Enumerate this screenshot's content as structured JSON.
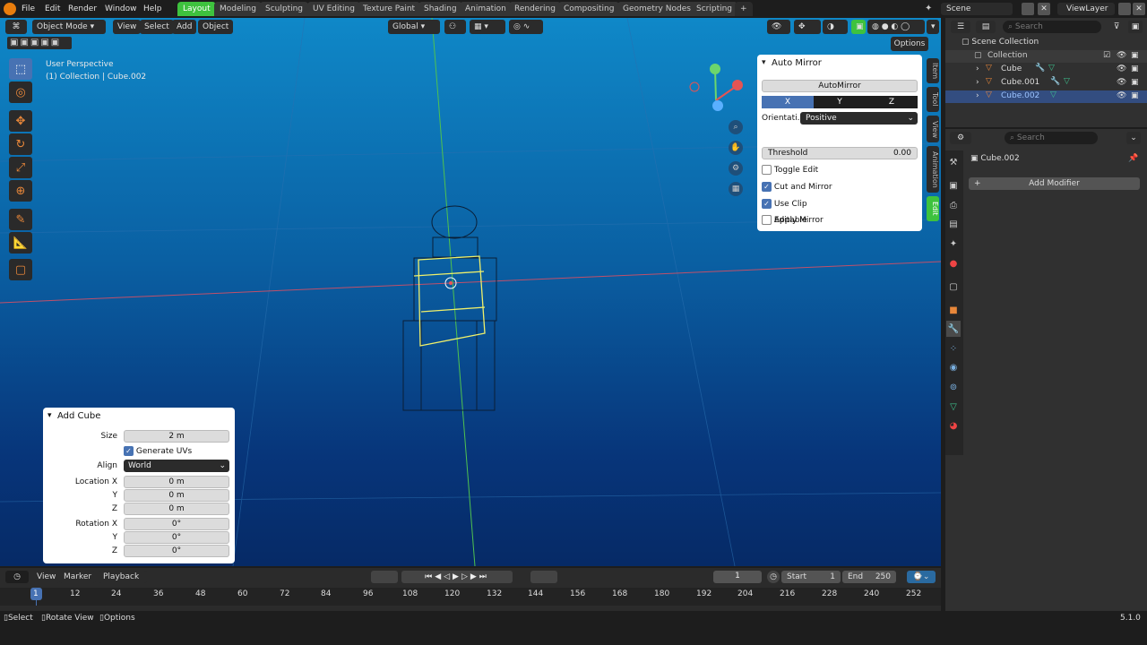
{
  "topbar": {
    "menus": [
      "File",
      "Edit",
      "Render",
      "Window",
      "Help"
    ],
    "workspaces": [
      "Layout",
      "Modeling",
      "Sculpting",
      "UV Editing",
      "Texture Paint",
      "Shading",
      "Animation",
      "Rendering",
      "Compositing",
      "Geometry Nodes",
      "Scripting"
    ],
    "active_workspace": "Layout",
    "add_tab": "+",
    "scene": "Scene",
    "view_layer": "ViewLayer"
  },
  "viewport": {
    "mode": "Object Mode",
    "menus": [
      "View",
      "Select",
      "Add",
      "Object"
    ],
    "orientation": "Global",
    "options": "Options",
    "info_line1": "User Perspective",
    "info_line2": "(1) Collection | Cube.002"
  },
  "side_tabs": [
    "Item",
    "Tool",
    "View",
    "Animation",
    "Edit"
  ],
  "auto_mirror": {
    "title": "Auto Mirror",
    "button": "AutoMirror",
    "axes": [
      "X",
      "Y",
      "Z"
    ],
    "orientation_label": "Orientati...",
    "orientation_value": "Positive",
    "threshold_label": "Threshold",
    "threshold_value": "0.00",
    "options": [
      {
        "label": "Toggle Edit",
        "checked": false
      },
      {
        "label": "Cut and Mirror",
        "checked": true
      },
      {
        "label": "Use Clip",
        "checked": true
      },
      {
        "label": "Editable",
        "checked": false
      },
      {
        "label": "Apply Mirror",
        "checked": false
      }
    ]
  },
  "add_cube": {
    "title": "Add Cube",
    "size_label": "Size",
    "size_value": "2 m",
    "generate_uvs": "Generate UVs",
    "align_label": "Align",
    "align_value": "World",
    "loc_x_label": "Location X",
    "y_label": "Y",
    "z_label": "Z",
    "loc_x": "0 m",
    "loc_y": "0 m",
    "loc_z": "0 m",
    "rot_x_label": "Rotation X",
    "rot_x": "0°",
    "rot_y": "0°",
    "rot_z": "0°"
  },
  "outliner": {
    "search_placeholder": "Search",
    "scene_collection": "Scene Collection",
    "collection": "Collection",
    "objects": [
      "Cube",
      "Cube.001",
      "Cube.002"
    ],
    "selected": "Cube.002"
  },
  "properties": {
    "search_placeholder": "Search",
    "object_name": "Cube.002",
    "add_modifier": "Add Modifier"
  },
  "timeline": {
    "menus": [
      "View",
      "Marker",
      "Playback"
    ],
    "current_frame": "1",
    "start_label": "Start",
    "start": "1",
    "end_label": "End",
    "end": "250",
    "ticks": [
      "1",
      "12",
      "24",
      "36",
      "48",
      "60",
      "72",
      "84",
      "96",
      "108",
      "120",
      "132",
      "144",
      "156",
      "168",
      "180",
      "192",
      "204",
      "216",
      "228",
      "240",
      "252"
    ]
  },
  "statusbar": {
    "select": "Select",
    "rotate": "Rotate View",
    "options": "Options",
    "version": "5.1.0"
  }
}
